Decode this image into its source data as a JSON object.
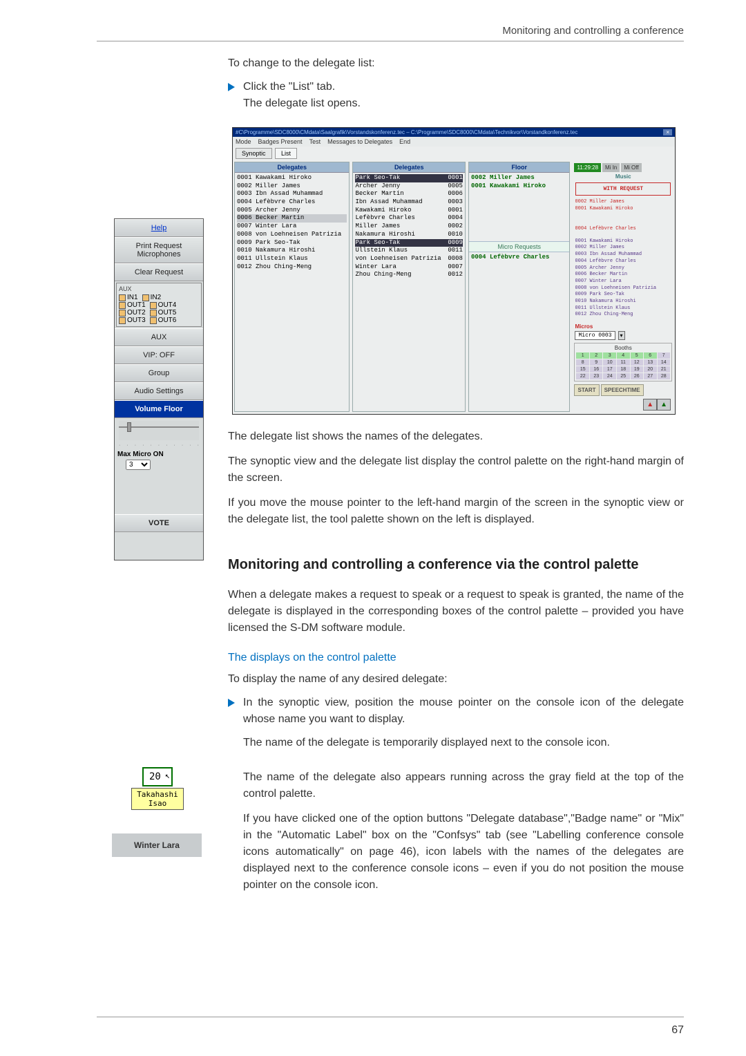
{
  "header": {
    "title": "Monitoring and controlling a conference"
  },
  "footer": {
    "page": "67"
  },
  "body": {
    "intro": "To change to the delegate list:",
    "step1_a": "Click the \"List\" tab.",
    "step1_b": "The delegate list opens.",
    "p1": "The delegate list shows the names of the delegates.",
    "p2": "The synoptic view and the delegate list display the control palette on the right-hand margin of the screen.",
    "p3": "If you move the mouse pointer to the left-hand margin of the screen in the synoptic view or the delegate list, the tool palette shown on the left is displayed.",
    "h2": "Monitoring and controlling a conference via the control palette",
    "p4": "When a delegate makes a request to speak or a request to speak is granted, the name of the delegate is displayed in the corresponding boxes of the control palette – provided you have licensed the S-DM software module.",
    "h3": "The displays on the control palette",
    "p5": "To display the name of any desired delegate:",
    "step2": "In the synoptic view, position the mouse pointer on the console icon of the delegate whose name you want to display.",
    "p6": "The name of the delegate is temporarily displayed next to the console icon.",
    "p7": "The name of the delegate also appears running across the gray field at the top of the control palette.",
    "p8": "If you have clicked one of the option buttons \"Delegate database\",\"Badge name\" or \"Mix\" in the \"Automatic Label\" box on the \"Confsys\" tab (see \"Labelling conference console icons automatically\" on page 46), icon labels with the names of the delegates are displayed next to the conference console icons – even if you do not position the mouse pointer on the console icon."
  },
  "tool_palette": {
    "help": "Help",
    "printreq": "Print Request Microphones",
    "clearreq": "Clear Request",
    "aux_title": "AUX",
    "in1": "IN1",
    "in2": "IN2",
    "out1": "OUT1",
    "out4": "OUT4",
    "out2": "OUT2",
    "out5": "OUT5",
    "out3": "OUT3",
    "out6": "OUT6",
    "aux": "AUX",
    "vipoff": "VIP: OFF",
    "group": "Group",
    "audio": "Audio Settings",
    "vf": "Volume Floor",
    "maxmic": "Max Micro ON",
    "maxmic_val": "3",
    "vote": "VOTE"
  },
  "mini": {
    "num": "20",
    "label": "Takahashi Isao",
    "gray": "Winter  Lara"
  },
  "shot": {
    "title": "#C\\Programme\\SDC8000\\CMdata\\Saalgrafik\\Vorstandskonferenz.tec – C:\\Programme\\SDC8000\\CMdata\\Technikvor\\Vorstandkonferenz.tec",
    "menu": [
      "Mode",
      "Badges Present",
      "Test",
      "Messages to Delegates",
      "End"
    ],
    "tab_syn": "Synoptic",
    "tab_list": "List",
    "col1_h": "Delegates",
    "col2_h": "Delegates",
    "col3_h": "Floor",
    "col1": [
      "0001 Kawakami Hiroko",
      "0002 Miller James",
      "0003 Ibn Assad Muhammad",
      "0004 Lefèbvre Charles",
      "0005 Archer Jenny",
      "0006 Becker Martin",
      "0007 Winter Lara",
      "0008 von Loehneisen Patrizia",
      "0009 Park Seo-Tak",
      "0010 Nakamura Hiroshi",
      "0011 Ullstein Klaus",
      "0012 Zhou Ching-Meng"
    ],
    "col1_hl_gray_idx": 5,
    "col2_hl_dark_row": {
      "name": "Park Seo-Tak",
      "id": "0001"
    },
    "col2": [
      {
        "n": "Archer Jenny",
        "i": "0005"
      },
      {
        "n": "Becker Martin",
        "i": "0006"
      },
      {
        "n": "Ibn Assad Muhammad",
        "i": "0003"
      },
      {
        "n": "Kawakami Hiroko",
        "i": "0001"
      },
      {
        "n": "Lefèbvre Charles",
        "i": "0004"
      },
      {
        "n": "Miller James",
        "i": "0002"
      },
      {
        "n": "Nakamura Hiroshi",
        "i": "0010"
      }
    ],
    "col2_hl_dark_row2": {
      "name": "Park Seo-Tak",
      "id": "0009"
    },
    "col2b": [
      {
        "n": "Ullstein Klaus",
        "i": "0011"
      },
      {
        "n": "von Loehneisen Patrizia",
        "i": "0008"
      },
      {
        "n": "Winter Lara",
        "i": "0007"
      },
      {
        "n": "Zhou Ching-Meng",
        "i": "0012"
      }
    ],
    "col3_floor": [
      "0002 Miller James",
      "0001 Kawakami Hiroko"
    ],
    "col3_req_h": "Micro Requests",
    "col3_req": [
      "0004 Lefèbvre Charles"
    ],
    "clock_time": "11:29:28",
    "clock_mi": "Mi In",
    "clock_mo": "Mi Off",
    "music": "Music",
    "withreq": "WITH REQUEST",
    "r_floor_names": [
      "0002 Miller James",
      "0001 Kawakami Hiroko"
    ],
    "r_req_name": "0004 Lefèbvre Charles",
    "r_all": [
      "0001 Kawakami Hiroko",
      "0002 Miller James",
      "0003 Ibn Assad Muhammad",
      "0004 Lefèbvre Charles",
      "0005 Archer Jenny",
      "0006 Becker Martin",
      "0007 Winter Lara",
      "0008 von Loehneisen Patrizia",
      "0009 Park Seo-Tak",
      "0010 Nakamura Hiroshi",
      "0011 Ullstein Klaus",
      "0012 Zhou Ching-Meng"
    ],
    "micros": "Micros",
    "micro_sel": "Micro 0003",
    "booths": "Booths",
    "start": "START",
    "speechtime": "SPEECHTIME"
  }
}
